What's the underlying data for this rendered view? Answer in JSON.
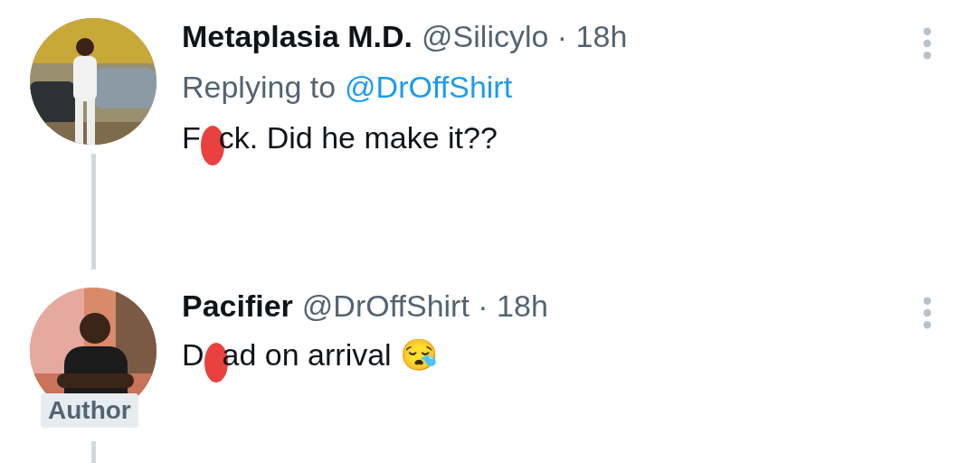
{
  "tweets": [
    {
      "name": "Metaplasia M.D.",
      "meta": "@Silicylo · 18h",
      "reply": {
        "prefix": "Replying to",
        "handle": "@DrOffShirt"
      },
      "text": [
        "F",
        "ck. Did he make it??"
      ]
    },
    {
      "name": "Pacifier",
      "meta": "@DrOffShirt · 18h",
      "badge": "Author",
      "text": [
        "D",
        "ad on arrival 😪"
      ]
    }
  ]
}
